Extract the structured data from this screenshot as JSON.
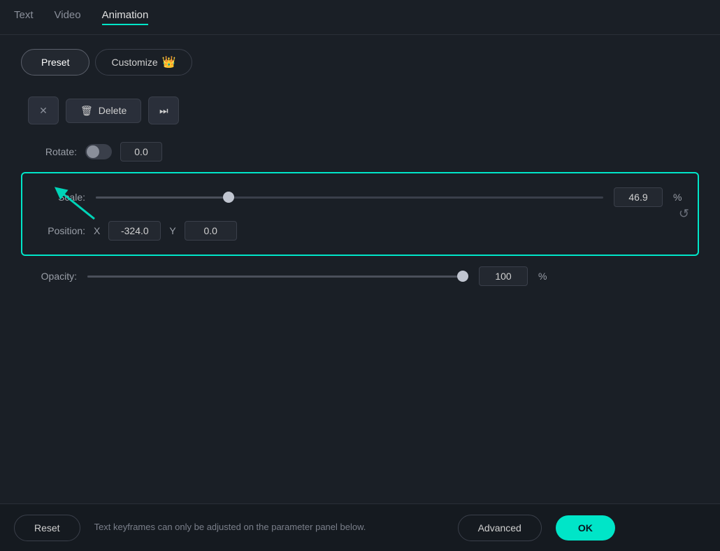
{
  "tabs": [
    {
      "id": "text",
      "label": "Text",
      "active": false
    },
    {
      "id": "video",
      "label": "Video",
      "active": false
    },
    {
      "id": "animation",
      "label": "Animation",
      "active": true
    }
  ],
  "toggle": {
    "preset_label": "Preset",
    "customize_label": "Customize",
    "crown": "👑"
  },
  "buttons": {
    "delete_label": "Delete",
    "skip_icon": "⏭"
  },
  "rotate": {
    "label": "Rotate:",
    "value": "0.0"
  },
  "scale": {
    "label": "Scale:",
    "value": "46.9",
    "unit": "%",
    "thumb_position_pct": 25
  },
  "position": {
    "label": "Position:",
    "x_label": "X",
    "x_value": "-324.0",
    "y_label": "Y",
    "y_value": "0.0"
  },
  "opacity": {
    "label": "Opacity:",
    "value": "100",
    "unit": "%"
  },
  "bottom_bar": {
    "reset_label": "Reset",
    "info_text": "Text keyframes can only be adjusted on the parameter panel below.",
    "advanced_label": "Advanced",
    "ok_label": "OK"
  }
}
